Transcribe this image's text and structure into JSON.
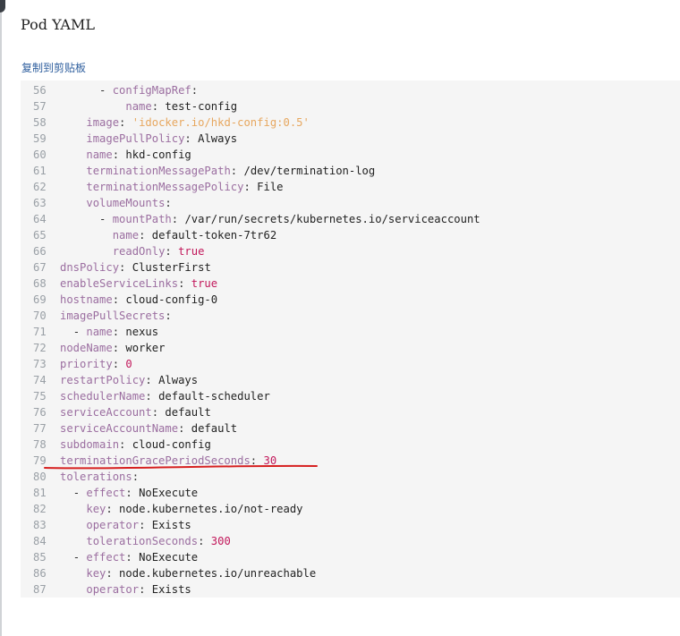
{
  "dialog": {
    "title": "Pod YAML",
    "copy_label": "复制到剪贴板"
  },
  "yaml_lines": [
    {
      "n": "56",
      "indent": "      ",
      "dash": "- ",
      "key": "configMapRef",
      "sep": ":",
      "val": "",
      "vtype": "plain"
    },
    {
      "n": "57",
      "indent": "          ",
      "dash": "",
      "key": "name",
      "sep": ":",
      "val": " test-config",
      "vtype": "plain"
    },
    {
      "n": "58",
      "indent": "    ",
      "dash": "",
      "key": "image",
      "sep": ":",
      "val": " 'idocker.io/hkd-config:0.5'",
      "vtype": "string"
    },
    {
      "n": "59",
      "indent": "    ",
      "dash": "",
      "key": "imagePullPolicy",
      "sep": ":",
      "val": " Always",
      "vtype": "plain"
    },
    {
      "n": "60",
      "indent": "    ",
      "dash": "",
      "key": "name",
      "sep": ":",
      "val": " hkd-config",
      "vtype": "plain"
    },
    {
      "n": "61",
      "indent": "    ",
      "dash": "",
      "key": "terminationMessagePath",
      "sep": ":",
      "val": " /dev/termination-log",
      "vtype": "plain"
    },
    {
      "n": "62",
      "indent": "    ",
      "dash": "",
      "key": "terminationMessagePolicy",
      "sep": ":",
      "val": " File",
      "vtype": "plain"
    },
    {
      "n": "63",
      "indent": "    ",
      "dash": "",
      "key": "volumeMounts",
      "sep": ":",
      "val": "",
      "vtype": "plain"
    },
    {
      "n": "64",
      "indent": "      ",
      "dash": "- ",
      "key": "mountPath",
      "sep": ":",
      "val": " /var/run/secrets/kubernetes.io/serviceaccount",
      "vtype": "plain"
    },
    {
      "n": "65",
      "indent": "        ",
      "dash": "",
      "key": "name",
      "sep": ":",
      "val": " default-token-7tr62",
      "vtype": "plain"
    },
    {
      "n": "66",
      "indent": "        ",
      "dash": "",
      "key": "readOnly",
      "sep": ":",
      "val": " true",
      "vtype": "bool"
    },
    {
      "n": "67",
      "indent": "",
      "dash": "",
      "key": "dnsPolicy",
      "sep": ":",
      "val": " ClusterFirst",
      "vtype": "plain"
    },
    {
      "n": "68",
      "indent": "",
      "dash": "",
      "key": "enableServiceLinks",
      "sep": ":",
      "val": " true",
      "vtype": "bool"
    },
    {
      "n": "69",
      "indent": "",
      "dash": "",
      "key": "hostname",
      "sep": ":",
      "val": " cloud-config-0",
      "vtype": "plain"
    },
    {
      "n": "70",
      "indent": "",
      "dash": "",
      "key": "imagePullSecrets",
      "sep": ":",
      "val": "",
      "vtype": "plain"
    },
    {
      "n": "71",
      "indent": "  ",
      "dash": "- ",
      "key": "name",
      "sep": ":",
      "val": " nexus",
      "vtype": "plain"
    },
    {
      "n": "72",
      "indent": "",
      "dash": "",
      "key": "nodeName",
      "sep": ":",
      "val": " worker",
      "vtype": "plain"
    },
    {
      "n": "73",
      "indent": "",
      "dash": "",
      "key": "priority",
      "sep": ":",
      "val": " 0",
      "vtype": "num"
    },
    {
      "n": "74",
      "indent": "",
      "dash": "",
      "key": "restartPolicy",
      "sep": ":",
      "val": " Always",
      "vtype": "plain"
    },
    {
      "n": "75",
      "indent": "",
      "dash": "",
      "key": "schedulerName",
      "sep": ":",
      "val": " default-scheduler",
      "vtype": "plain"
    },
    {
      "n": "76",
      "indent": "",
      "dash": "",
      "key": "serviceAccount",
      "sep": ":",
      "val": " default",
      "vtype": "plain"
    },
    {
      "n": "77",
      "indent": "",
      "dash": "",
      "key": "serviceAccountName",
      "sep": ":",
      "val": " default",
      "vtype": "plain"
    },
    {
      "n": "78",
      "indent": "",
      "dash": "",
      "key": "subdomain",
      "sep": ":",
      "val": " cloud-config",
      "vtype": "plain"
    },
    {
      "n": "79",
      "indent": "",
      "dash": "",
      "key": "terminationGracePeriodSeconds",
      "sep": ":",
      "val": " 30",
      "vtype": "num"
    },
    {
      "n": "80",
      "indent": "",
      "dash": "",
      "key": "tolerations",
      "sep": ":",
      "val": "",
      "vtype": "plain"
    },
    {
      "n": "81",
      "indent": "  ",
      "dash": "- ",
      "key": "effect",
      "sep": ":",
      "val": " NoExecute",
      "vtype": "plain"
    },
    {
      "n": "82",
      "indent": "    ",
      "dash": "",
      "key": "key",
      "sep": ":",
      "val": " node.kubernetes.io/not-ready",
      "vtype": "plain"
    },
    {
      "n": "83",
      "indent": "    ",
      "dash": "",
      "key": "operator",
      "sep": ":",
      "val": " Exists",
      "vtype": "plain"
    },
    {
      "n": "84",
      "indent": "    ",
      "dash": "",
      "key": "tolerationSeconds",
      "sep": ":",
      "val": " 300",
      "vtype": "num"
    },
    {
      "n": "85",
      "indent": "  ",
      "dash": "- ",
      "key": "effect",
      "sep": ":",
      "val": " NoExecute",
      "vtype": "plain"
    },
    {
      "n": "86",
      "indent": "    ",
      "dash": "",
      "key": "key",
      "sep": ":",
      "val": " node.kubernetes.io/unreachable",
      "vtype": "plain"
    },
    {
      "n": "87",
      "indent": "    ",
      "dash": "",
      "key": "operator",
      "sep": ":",
      "val": " Exists",
      "vtype": "plain"
    }
  ],
  "colors": {
    "key": "#9b6ea0",
    "string": "#e7a75f",
    "literal": "#c2185b",
    "line_number": "#9aa0a6",
    "annotation": "#d62020"
  }
}
